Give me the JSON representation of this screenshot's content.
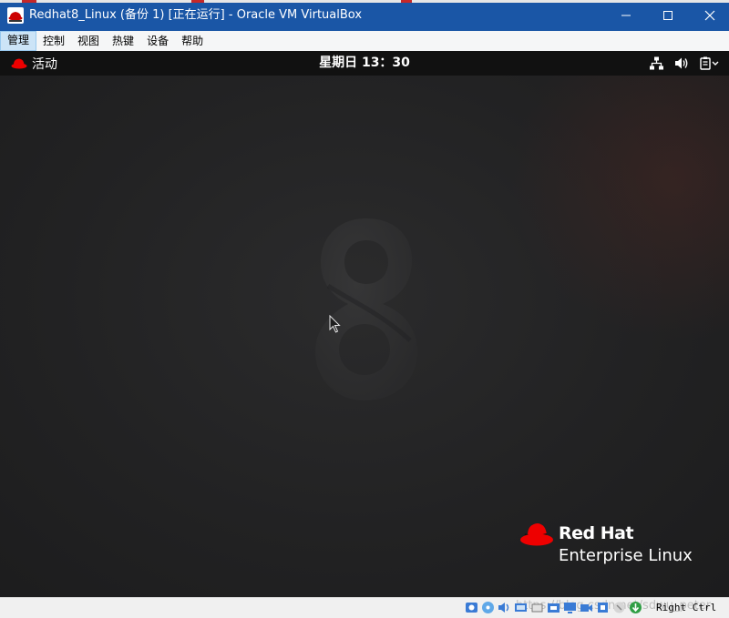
{
  "window": {
    "title": "Redhat8_Linux (备份 1) [正在运行] - Oracle VM VirtualBox",
    "controls": {
      "minimize": "—",
      "maximize": "☐",
      "close": "✕"
    }
  },
  "menubar": {
    "items": [
      {
        "label": "管理"
      },
      {
        "label": "控制"
      },
      {
        "label": "视图"
      },
      {
        "label": "热键"
      },
      {
        "label": "设备"
      },
      {
        "label": "帮助"
      }
    ]
  },
  "guest": {
    "topbar": {
      "activities_label": "活动",
      "clock": "星期日 13：30"
    },
    "brand": {
      "line1": "Red Hat",
      "line2": "Enterprise Linux"
    }
  },
  "statusbar": {
    "host_key": "Right Ctrl",
    "watermark": "https://blog.csdn.net/sdwu_peter"
  },
  "colors": {
    "titlebar": "#1a56a6",
    "redhat_red": "#ee0000",
    "guest_bg": "#222223",
    "topbar_bg": "#111111"
  }
}
